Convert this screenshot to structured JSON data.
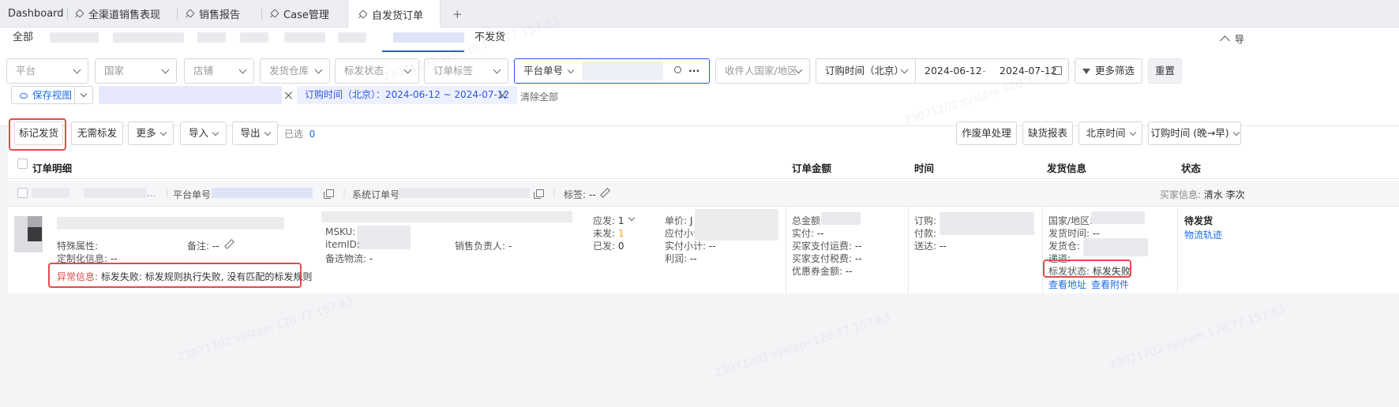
{
  "tabs": [
    {
      "label": "Dashboard"
    },
    {
      "label": "全渠道销售表现"
    },
    {
      "label": "销售报告"
    },
    {
      "label": "Case管理"
    },
    {
      "label": "自发货订单"
    }
  ],
  "tab_add": "+",
  "subtabs": {
    "all": "全部",
    "no_ship": "不发货"
  },
  "export_label": "导",
  "filters": {
    "platform": "平台",
    "country": "国家",
    "shop": "店铺",
    "warehouse": "发货仓库",
    "mark_status": "标发状态",
    "order_tag": "订单标签",
    "platform_no": "平台单号",
    "recipient_country": "收件人国家/地区",
    "order_time": "订购时间（北京）",
    "date_start": "2024-06-12",
    "date_sep": "-",
    "date_end": "2024-07-12",
    "more": "更多筛选",
    "reset": "重置"
  },
  "view": {
    "save": "保存视图",
    "active_tag": "订购时间（北京）：2024-06-12 ~ 2024-07-12",
    "clear_all": "清除全部"
  },
  "toolbar": {
    "mark_ship": "标记发货",
    "no_mark": "无需标发",
    "more": "更多",
    "import": "导入",
    "export": "导出",
    "selected": "已选",
    "selected_count": "0",
    "void": "作废单处理",
    "shortage": "缺货报表",
    "timezone": "北京时间",
    "sort": "订购时间 (晚→早)"
  },
  "columns": {
    "detail": "订单明细",
    "amount": "订单金额",
    "time": "时间",
    "ship": "发货信息",
    "status": "状态"
  },
  "group": {
    "platform_no": "平台单号:",
    "sys_no": "系统订单号:",
    "tag_label": "标签:",
    "tag_val": "--",
    "buyer": "买家信息:",
    "buyer_val": "清水 李次"
  },
  "order": {
    "special_attr": "特殊属性:",
    "remark": "备注:",
    "remark_val": "--",
    "custom_info": "定制化信息:",
    "custom_val": "--",
    "msku": "MSKU:",
    "itemid": "itemID:",
    "alt_logistics": "备选物流:",
    "alt_val": "-",
    "sales_owner": "销售负责人:",
    "sales_val": "-",
    "should_ship": "应发:",
    "should_val": "1",
    "unshipped": "未发:",
    "unshipped_val": "1",
    "shipped": "已发:",
    "shipped_val": "0",
    "unit_price": "单价:",
    "unit_val": "J",
    "due_subtotal": "应付小计",
    "paid_subtotal": "实付小计:",
    "paid_val": "--",
    "profit": "利润:",
    "profit_val": "--",
    "abnormal_label": "异常信息:",
    "abnormal_text": "标发失败: 标发规则执行失败, 没有匹配的标发规则"
  },
  "amount": {
    "total": "总金额:",
    "paid": "实付:",
    "paid_val": "--",
    "buyer_shipping": "买家支付运费:",
    "buyer_shipping_val": "--",
    "buyer_tax": "买家支付税费:",
    "buyer_tax_val": "--",
    "coupon": "优惠券金额:",
    "coupon_val": "--"
  },
  "time": {
    "order": "订购:",
    "pay": "付款:",
    "deliver": "送达:",
    "deliver_val": "--"
  },
  "ship": {
    "country": "国家/地区:",
    "ship_time": "发货时间:",
    "ship_time_val": "--",
    "warehouse": "发货仓:",
    "logistics": "递道:",
    "mark_status": "标发状态:",
    "mark_status_val": "标发失败",
    "view_address": "查看地址",
    "view_attach": "查看附件"
  },
  "status": {
    "pending": "待发货",
    "track": "物流轨迹"
  },
  "watermark": "23071202 system 120.77.157.63",
  "colors": {
    "accent": "#1f6feb",
    "alert": "#e5484d",
    "pending_orange": "#f5a623"
  }
}
